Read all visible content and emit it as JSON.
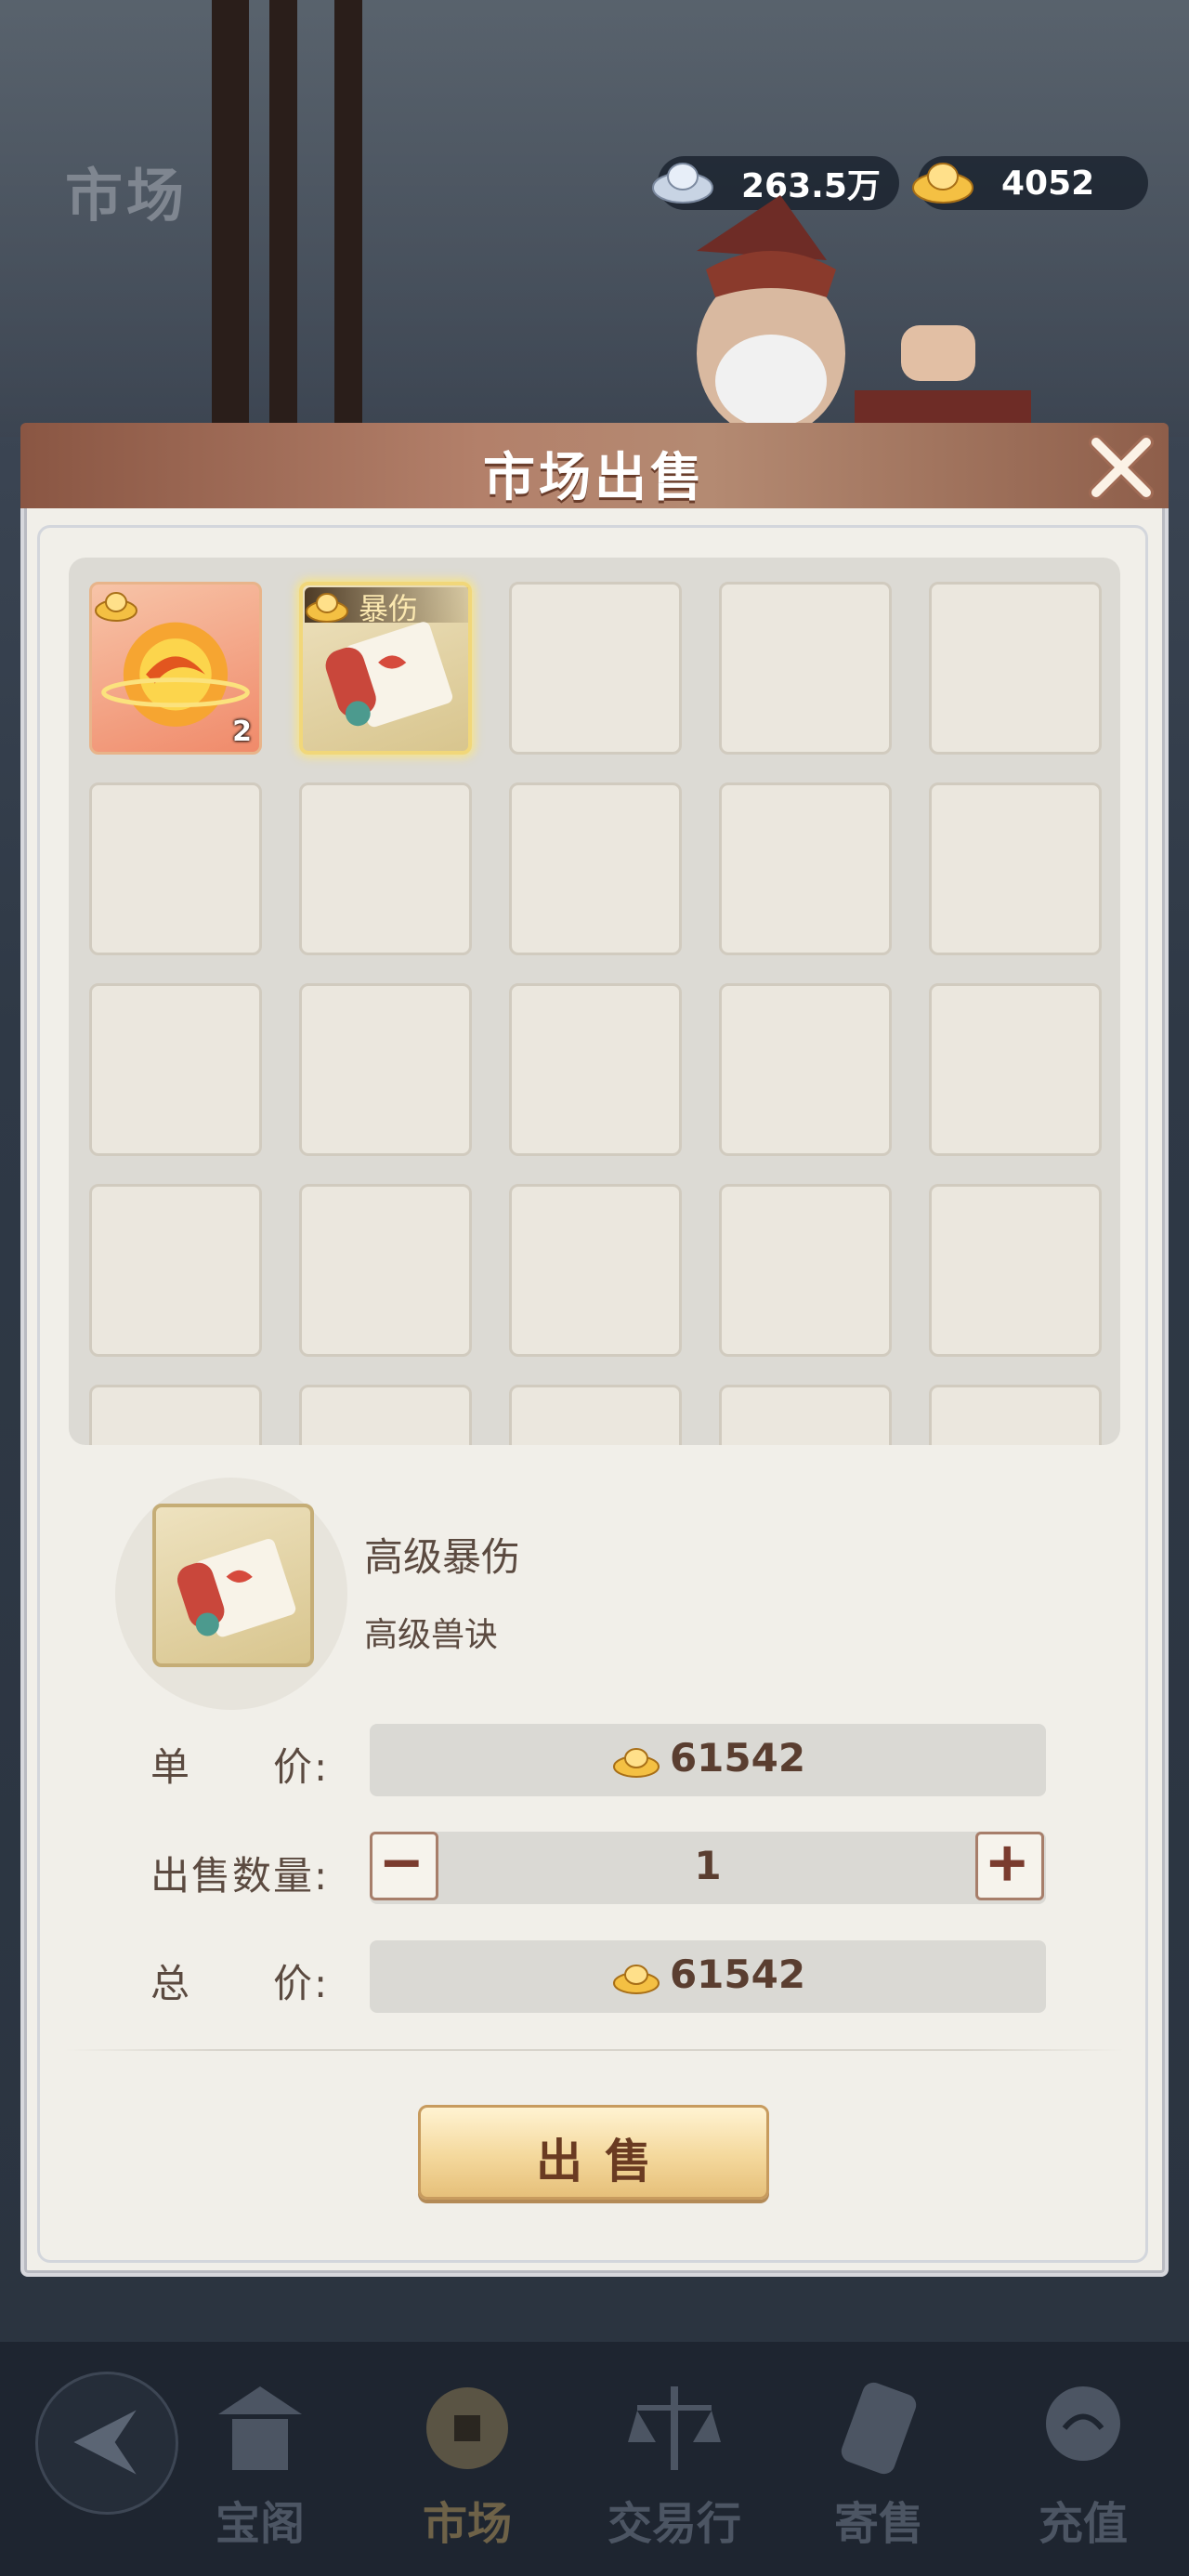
{
  "background": {
    "page_title": "市场",
    "currencies": [
      {
        "icon": "silver-ingot-icon",
        "value": "263.5万"
      },
      {
        "icon": "gold-ingot-icon",
        "value": "4052"
      }
    ]
  },
  "dialog": {
    "title": "市场出售",
    "close_icon": "close-icon",
    "slots": [
      {
        "icon": "fire-orb-icon",
        "count": "2",
        "badge": "gold-ingot-icon"
      },
      {
        "icon": "scroll-icon",
        "tag": "暴伤",
        "badge": "gold-ingot-icon",
        "selected": true
      }
    ],
    "selected_item": {
      "name": "高级暴伤",
      "type": "高级兽诀"
    },
    "unit_price": {
      "label": "单　　价:",
      "value": "61542"
    },
    "quantity": {
      "label": "出售数量:",
      "value": "1",
      "minus": "−",
      "plus": "+"
    },
    "total_price": {
      "label": "总　　价:",
      "value": "61542"
    },
    "sell_button": "出售"
  },
  "nav": {
    "items": [
      {
        "label": "宝阁",
        "icon": "pavilion-icon"
      },
      {
        "label": "市场",
        "icon": "coin-icon",
        "active": true
      },
      {
        "label": "交易行",
        "icon": "scales-icon"
      },
      {
        "label": "寄售",
        "icon": "consign-scroll-icon"
      },
      {
        "label": "充值",
        "icon": "cloud-icon"
      }
    ]
  },
  "colors": {
    "header_brown": "#8a5643",
    "text_brown": "#5b4a40",
    "gold": "#f1d77a"
  }
}
